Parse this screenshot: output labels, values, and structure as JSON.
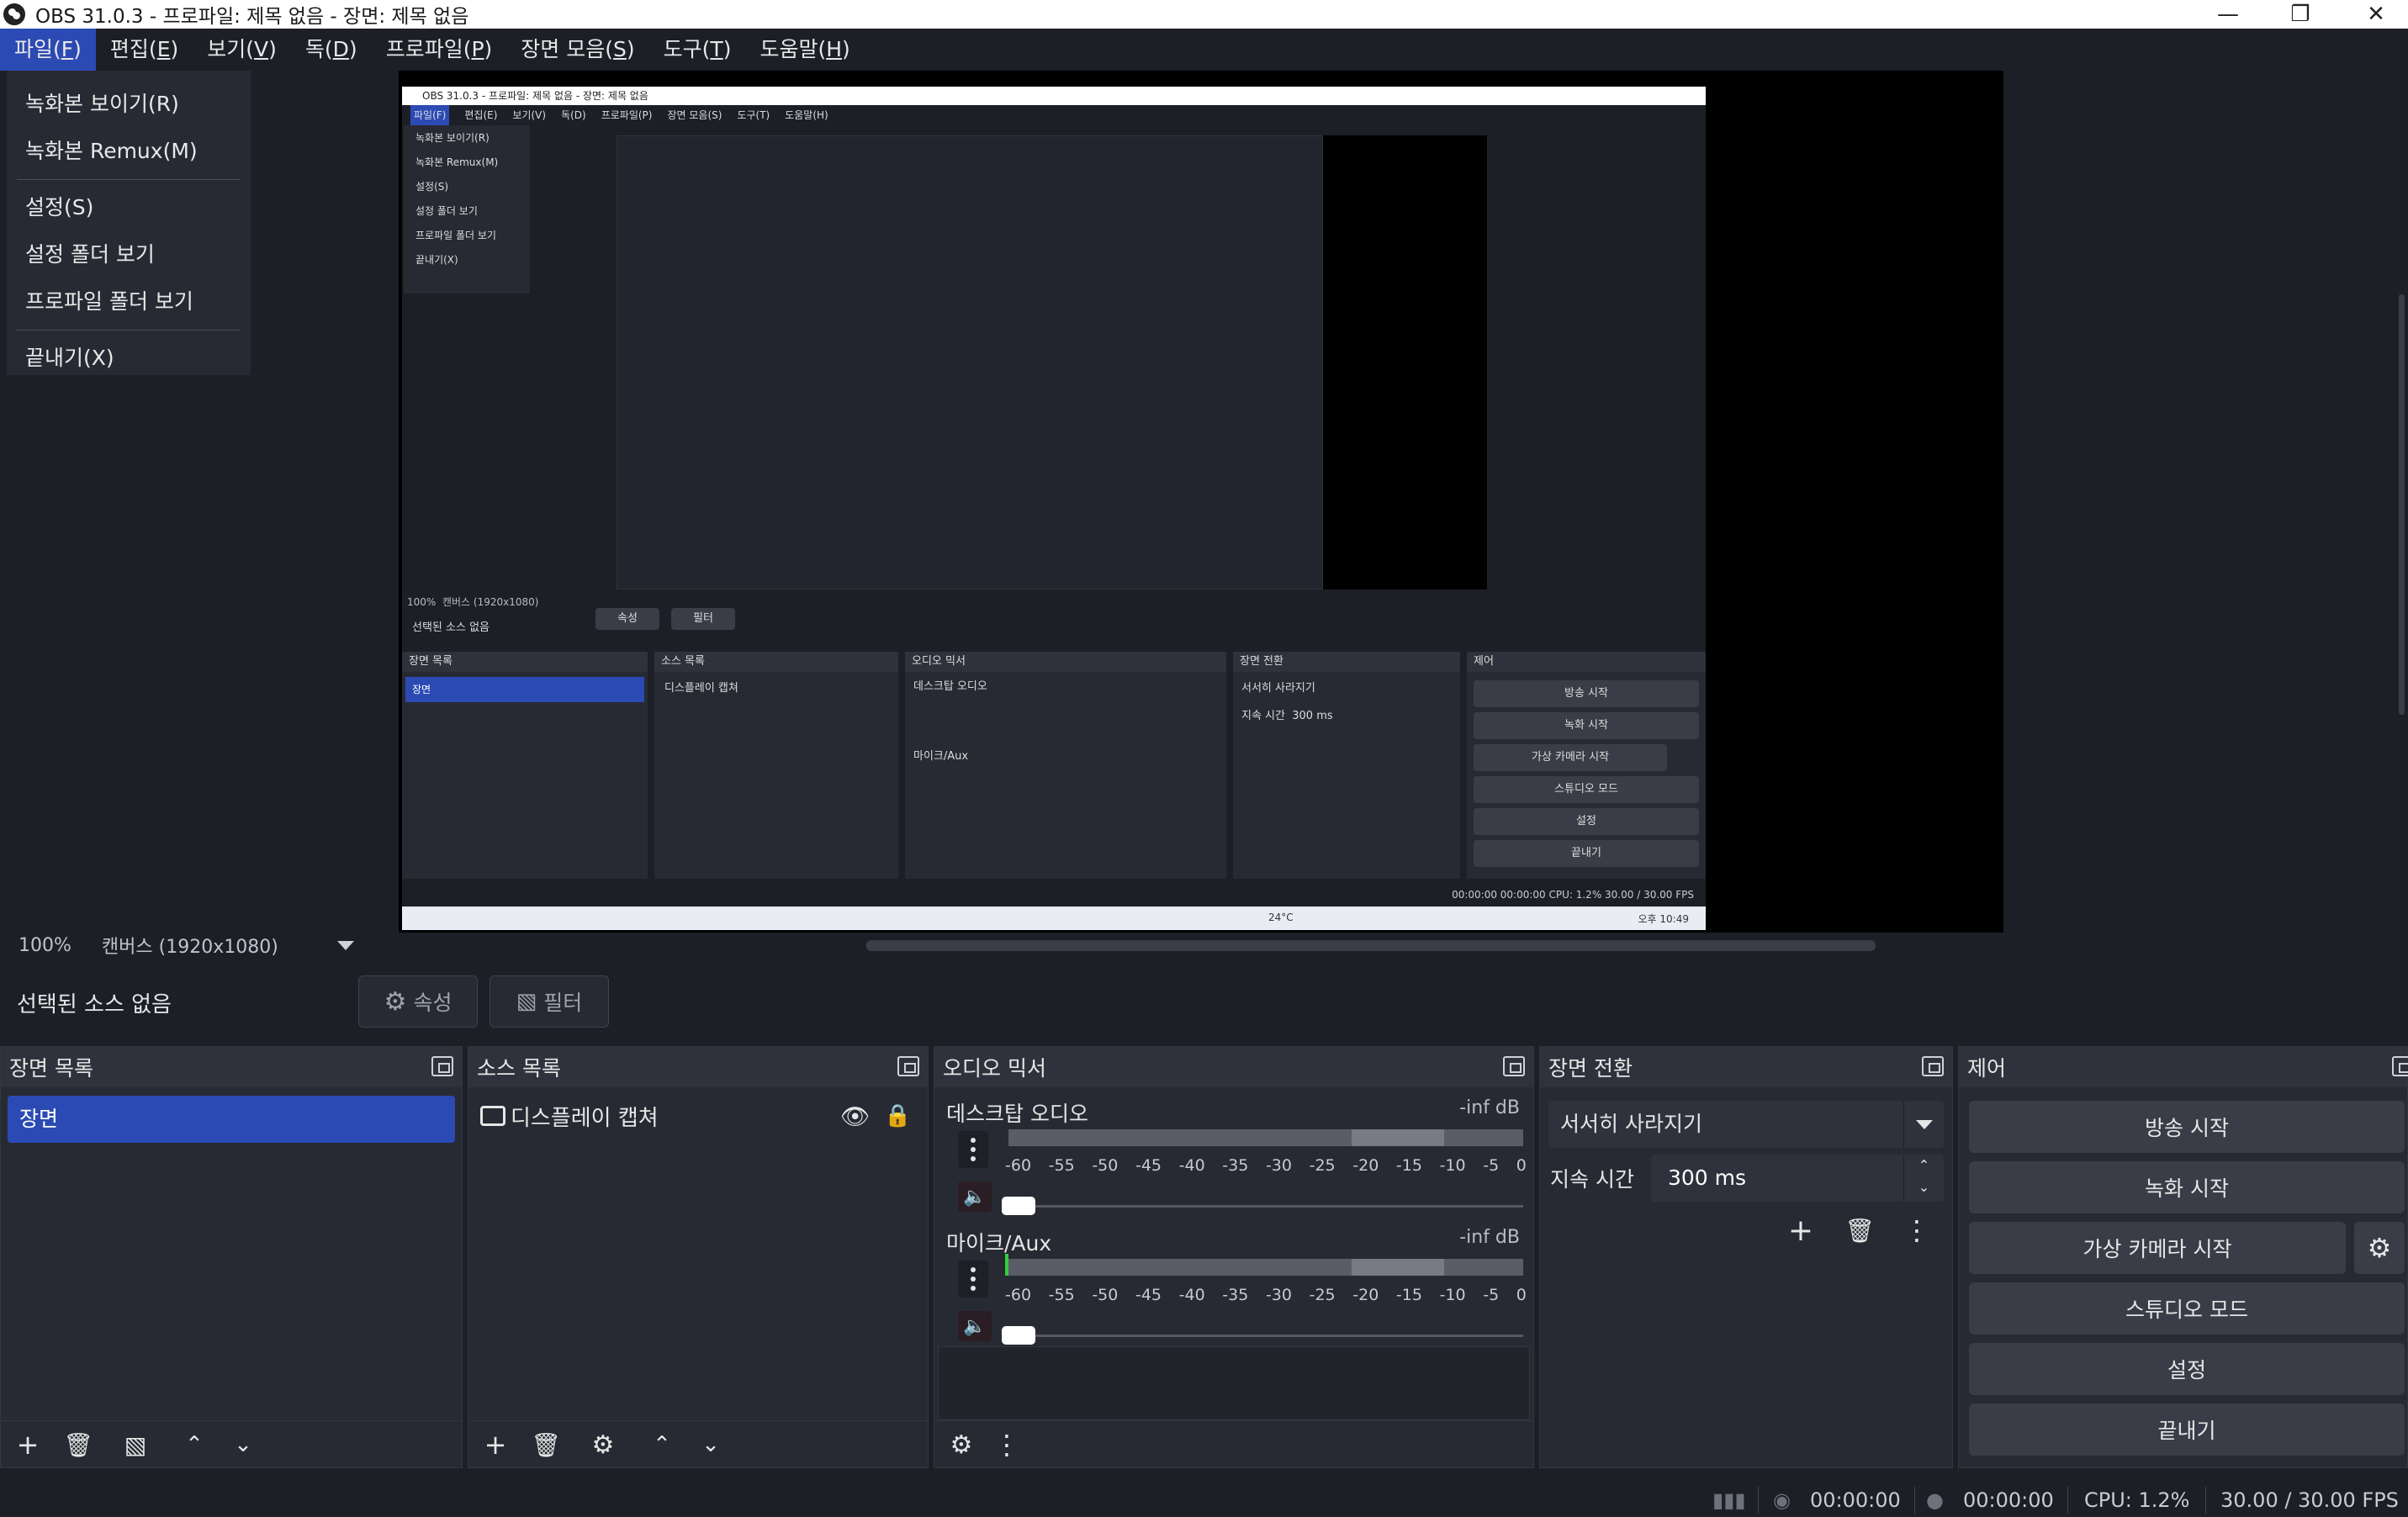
{
  "window": {
    "title": "OBS 31.0.3 - 프로파일: 제목 없음 - 장면: 제목 없음"
  },
  "menubar": {
    "items": [
      {
        "label": "파일(",
        "key": "F",
        "suffix": ")"
      },
      {
        "label": "편집(",
        "key": "E",
        "suffix": ")"
      },
      {
        "label": "보기(",
        "key": "V",
        "suffix": ")"
      },
      {
        "label": "독(",
        "key": "D",
        "suffix": ")"
      },
      {
        "label": "프로파일(",
        "key": "P",
        "suffix": ")"
      },
      {
        "label": "장면 모음(",
        "key": "S",
        "suffix": ")"
      },
      {
        "label": "도구(",
        "key": "T",
        "suffix": ")"
      },
      {
        "label": "도움말(",
        "key": "H",
        "suffix": ")"
      }
    ]
  },
  "file_menu": {
    "show_recordings": "녹화본 보이기(R)",
    "remux_recordings": "녹화본 Remux(M)",
    "settings": "설정(S)",
    "show_settings_folder": "설정 폴더 보기",
    "show_profile_folder": "프로파일 폴더 보기",
    "exit": "끝내기(X)"
  },
  "preview": {
    "zoom": "100%",
    "canvas_label": "캔버스 (1920x1080)"
  },
  "source_bar": {
    "no_source": "선택된 소스 없음",
    "properties_label": "속성",
    "filters_label": "필터"
  },
  "scenes": {
    "title": "장면 목록",
    "items": [
      "장면"
    ]
  },
  "sources": {
    "title": "소스 목록",
    "items": [
      "디스플레이 캡쳐"
    ]
  },
  "mixer": {
    "title": "오디오 믹서",
    "tracks": [
      {
        "name": "데스크탑 오디오",
        "level": "-inf dB"
      },
      {
        "name": "마이크/Aux",
        "level": "-inf dB"
      }
    ],
    "ticks": [
      "-60",
      "-55",
      "-50",
      "-45",
      "-40",
      "-35",
      "-30",
      "-25",
      "-20",
      "-15",
      "-10",
      "-5",
      "0"
    ]
  },
  "transitions": {
    "title": "장면 전환",
    "selected": "서서히 사라지기",
    "duration_label": "지속 시간",
    "duration_value": "300 ms"
  },
  "controls": {
    "title": "제어",
    "start_streaming": "방송 시작",
    "start_recording": "녹화 시작",
    "start_virtual_camera": "가상 카메라 시작",
    "studio_mode": "스튜디오 모드",
    "settings": "설정",
    "exit": "끝내기"
  },
  "statusbar": {
    "stream_time": "00:00:00",
    "record_time": "00:00:00",
    "cpu": "CPU: 1.2%",
    "fps": "30.00 / 30.00 FPS"
  },
  "nested": {
    "title": "OBS 31.0.3 - 프로파일: 제목 없음 - 장면: 제목 없음",
    "menu": [
      "파일(F)",
      "편집(E)",
      "보기(V)",
      "독(D)",
      "프로파일(P)",
      "장면 모음(S)",
      "도구(T)",
      "도움말(H)"
    ],
    "file_menu": [
      "녹화본 보이기(R)",
      "녹화본 Remux(M)",
      "설정(S)",
      "설정 폴더 보기",
      "프로파일 폴더 보기",
      "끝내기(X)"
    ],
    "zoom": "100%",
    "canvas_label": "캔버스 (1920x1080)",
    "no_source": "선택된 소스 없음",
    "properties_label": "속성",
    "filters_label": "필터",
    "scenes_title": "장면 목록",
    "scene_item": "장면",
    "sources_title": "소스 목록",
    "source_item": "디스플레이 캡쳐",
    "mixer_title": "오디오 믹서",
    "desktop_audio": "데스크탑 오디오",
    "mic_aux": "마이크/Aux",
    "transitions_title": "장면 전환",
    "transition_selected": "서서히 사라지기",
    "duration_label": "지속 시간",
    "duration_value": "300 ms",
    "controls_title": "제어",
    "start_streaming": "방송 시작",
    "start_recording": "녹화 시작",
    "start_virtual_camera": "가상 카메라 시작",
    "studio_mode": "스튜디오 모드",
    "settings": "설정",
    "exit": "끝내기",
    "status": "00:00:00   00:00:00   CPU: 1.2%   30.00 / 30.00 FPS",
    "taskbar_weather": "24°C",
    "taskbar_time": "오후 10:49"
  },
  "colors": {
    "background": "#1d1f26",
    "dock": "#272a33",
    "accent": "#2c4ab4",
    "mute": "#d03a4c"
  }
}
